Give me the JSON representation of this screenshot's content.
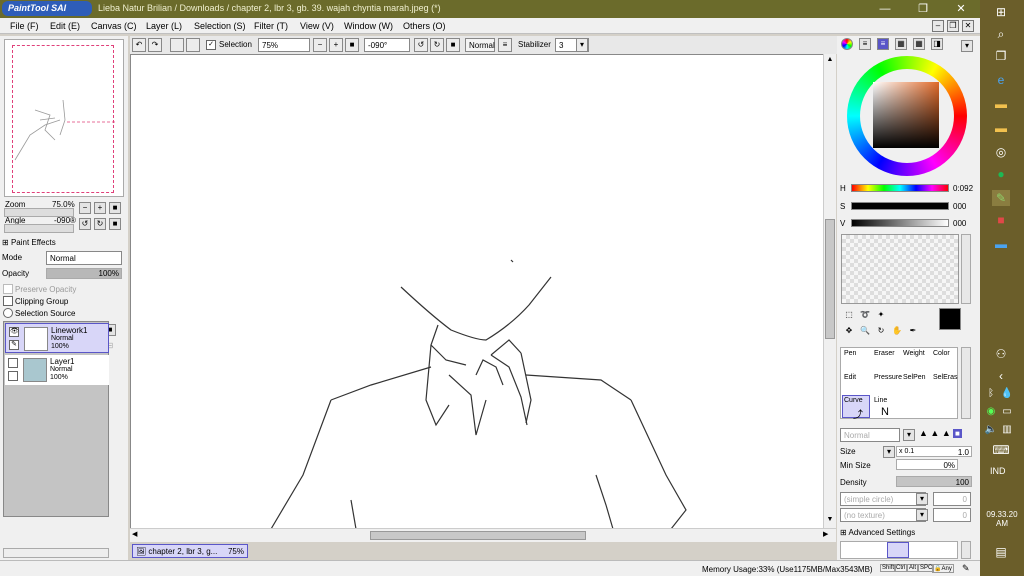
{
  "title_bar": {
    "logo_text": "PaintTool SAI",
    "title": "Lieba Natur Brilian / Downloads / chapter 2, lbr 3, gb. 39. wajah chyntia marah.jpeg (*)",
    "minimize": "—",
    "restore": "❐",
    "close": "✕"
  },
  "menu": {
    "items": [
      "File (F)",
      "Edit (E)",
      "Canvas (C)",
      "Layer (L)",
      "Selection (S)",
      "Filter (T)",
      "View (V)",
      "Window (W)",
      "Others (O)"
    ]
  },
  "toolbar": {
    "selection_label": "Selection",
    "zoom": "75%",
    "angle": "-090°",
    "blend": "Normal",
    "stabilizer_label": "Stabilizer",
    "stabilizer_value": "3"
  },
  "navigator": {
    "zoom_label": "Zoom",
    "zoom_value": "75.0%",
    "angle_label": "Angle",
    "angle_value": "-090®"
  },
  "layer_panel": {
    "paint_effects": "Paint Effects",
    "mode_label": "Mode",
    "mode_value": "Normal",
    "opacity_label": "Opacity",
    "opacity_value": "100%",
    "opacity_fraction": 1.0,
    "preserve_opacity": "Preserve Opacity",
    "clipping_group": "Clipping Group",
    "selection_source": "Selection Source",
    "layers": [
      {
        "name": "Linework1",
        "mode": "Normal",
        "opacity": "100%",
        "selected": true
      },
      {
        "name": "Layer1",
        "mode": "Normal",
        "opacity": "100%",
        "selected": false
      }
    ]
  },
  "color_panel": {
    "h_label": "H",
    "h_value": "0:092",
    "s_label": "S",
    "s_value": "000",
    "v_label": "V",
    "v_value": "000"
  },
  "tools": {
    "cells": [
      "Pen",
      "Eraser",
      "Weight",
      "Color",
      "Edit",
      "Pressure",
      "SelPen",
      "SelEras",
      "Curve",
      "Line"
    ],
    "blend": "Normal",
    "size_label": "Size",
    "size_mult": "x 0.1",
    "size_value": "1.0",
    "min_size_label": "Min Size",
    "min_size_value": "0%",
    "density_label": "Density",
    "density_value": "100",
    "shape": "(simple circle)",
    "shape_value": "0",
    "texture": "(no texture)",
    "texture_value": "0",
    "advanced": "Advanced Settings"
  },
  "document_tab": {
    "name": "chapter 2, lbr 3, g...",
    "zoom": "75%"
  },
  "status": {
    "memory": "Memory Usage:33% (Use1175MB/Max3543MB)",
    "keys": [
      "Shift",
      "Ctrl",
      "Alt",
      "SPC",
      "Any"
    ]
  },
  "taskbar": {
    "time": "09.33.20 AM",
    "lang": "IND"
  },
  "colors": {
    "titlebar": "#6b6b2b",
    "selected_layer": "#d8d6f8",
    "accent": "#5a56c8",
    "taskbar": "#6b5e2a"
  }
}
